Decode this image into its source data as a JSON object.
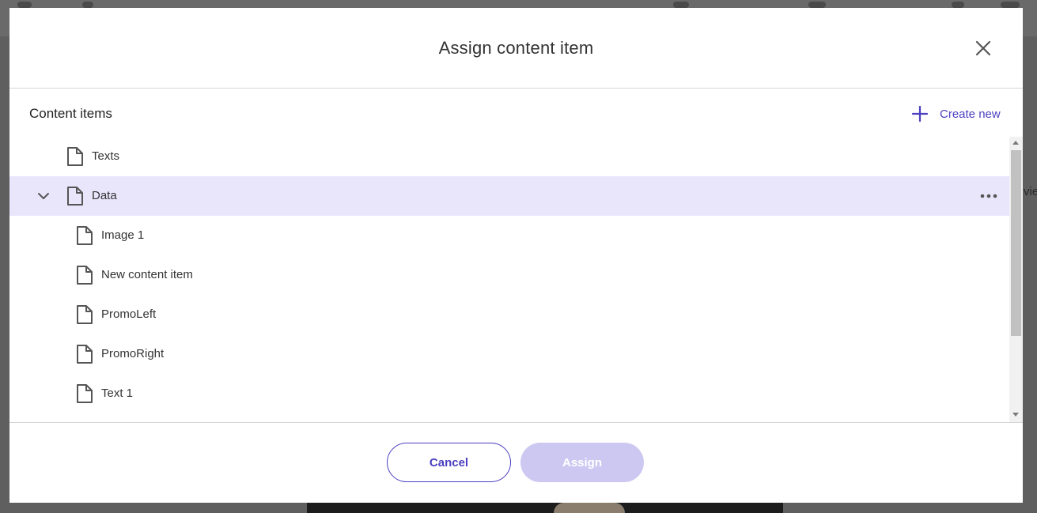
{
  "modal": {
    "title": "Assign content item",
    "section_title": "Content items",
    "create_new_label": "Create new"
  },
  "tree": {
    "items": [
      {
        "label": "Texts",
        "level": 0,
        "expanded": false,
        "selected": false
      },
      {
        "label": "Data",
        "level": 0,
        "expanded": true,
        "selected": true
      },
      {
        "label": "Image 1",
        "level": 1,
        "selected": false
      },
      {
        "label": "New content item",
        "level": 1,
        "selected": false
      },
      {
        "label": "PromoLeft",
        "level": 1,
        "selected": false
      },
      {
        "label": "PromoRight",
        "level": 1,
        "selected": false
      },
      {
        "label": "Text 1",
        "level": 1,
        "selected": false
      }
    ]
  },
  "footer": {
    "cancel_label": "Cancel",
    "assign_label": "Assign"
  },
  "background": {
    "side_text": "vie"
  },
  "colors": {
    "accent": "#4b3fc0",
    "selected_row": "#e9e6fc",
    "assign_disabled": "#cdc8f2",
    "overlay": "#5f5f5f"
  },
  "icons": {
    "close": "close-icon",
    "create": "plus-icon",
    "document": "document-icon",
    "expand": "chevron-down-icon",
    "more": "more-horizontal-icon"
  }
}
